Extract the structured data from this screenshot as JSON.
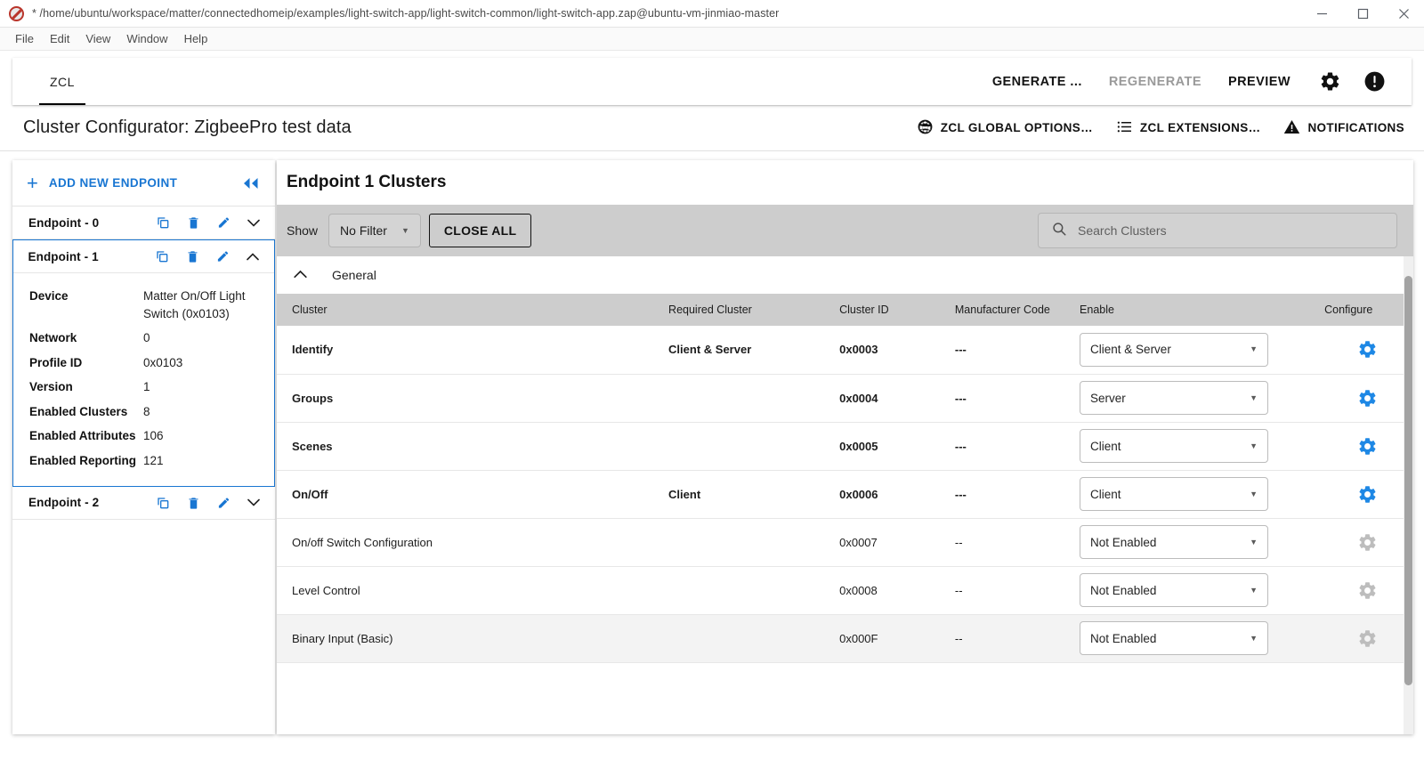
{
  "window": {
    "title": "* /home/ubuntu/workspace/matter/connectedhomeip/examples/light-switch-app/light-switch-common/light-switch-app.zap@ubuntu-vm-jinmiao-master",
    "logo_icon": "zap-logo-icon",
    "minimize_icon": "minimize-icon",
    "maximize_icon": "maximize-icon",
    "close_icon": "close-icon"
  },
  "menubar": {
    "items": [
      {
        "label": "File"
      },
      {
        "label": "Edit"
      },
      {
        "label": "View"
      },
      {
        "label": "Window"
      },
      {
        "label": "Help"
      }
    ]
  },
  "appbar": {
    "tabs": [
      {
        "label": "ZCL",
        "active": true
      }
    ],
    "actions": [
      {
        "label": "GENERATE ...",
        "disabled": false
      },
      {
        "label": "REGENERATE",
        "disabled": true
      },
      {
        "label": "PREVIEW",
        "disabled": false
      }
    ],
    "settings_icon": "gear-icon",
    "alert_icon": "exclamation-circle-icon"
  },
  "page_header": {
    "title": "Cluster Configurator: ZigbeePro test data",
    "actions": [
      {
        "label": "ZCL GLOBAL OPTIONS…",
        "icon": "globe-icon"
      },
      {
        "label": "ZCL EXTENSIONS…",
        "icon": "list-icon"
      },
      {
        "label": "NOTIFICATIONS",
        "icon": "warning-triangle-icon"
      }
    ]
  },
  "sidebar": {
    "add_endpoint_label": "ADD NEW ENDPOINT",
    "add_icon": "plus-icon",
    "collapse_icon": "collapse-left-icon",
    "row_icons": {
      "copy": "copy-icon",
      "delete": "trash-icon",
      "edit": "pencil-icon",
      "expand": "chevron-down-icon",
      "collapse": "chevron-up-icon"
    },
    "endpoints": [
      {
        "label": "Endpoint - 0",
        "expanded": false,
        "selected": false
      },
      {
        "label": "Endpoint - 1",
        "expanded": true,
        "selected": true
      },
      {
        "label": "Endpoint - 2",
        "expanded": false,
        "selected": false
      }
    ],
    "endpoint_detail": [
      {
        "key": "Device",
        "value": "Matter On/Off Light Switch (0x0103)"
      },
      {
        "key": "Network",
        "value": "0"
      },
      {
        "key": "Profile ID",
        "value": "0x0103"
      },
      {
        "key": "Version",
        "value": "1"
      },
      {
        "key": "Enabled Clusters",
        "value": "8"
      },
      {
        "key": "Enabled Attributes",
        "value": "106"
      },
      {
        "key": "Enabled Reporting",
        "value": "121"
      }
    ]
  },
  "content": {
    "title": "Endpoint 1 Clusters",
    "show_label": "Show",
    "filter_value": "No Filter",
    "close_all_label": "CLOSE ALL",
    "search": {
      "placeholder": "Search Clusters",
      "value": "",
      "icon": "search-icon"
    },
    "group": {
      "name": "General",
      "expanded": true,
      "icon": "chevron-up-icon"
    },
    "columns": [
      "Cluster",
      "Required Cluster",
      "Cluster ID",
      "Manufacturer Code",
      "Enable",
      "Configure"
    ],
    "rows": [
      {
        "cluster": "Identify",
        "required": "Client & Server",
        "id": "0x0003",
        "mfg": "---",
        "enable": "Client & Server",
        "enabled": true,
        "hover": false,
        "configure_icon": "gear-icon"
      },
      {
        "cluster": "Groups",
        "required": "",
        "id": "0x0004",
        "mfg": "---",
        "enable": "Server",
        "enabled": true,
        "hover": false,
        "configure_icon": "gear-icon"
      },
      {
        "cluster": "Scenes",
        "required": "",
        "id": "0x0005",
        "mfg": "---",
        "enable": "Client",
        "enabled": true,
        "hover": false,
        "configure_icon": "gear-icon"
      },
      {
        "cluster": "On/Off",
        "required": "Client",
        "id": "0x0006",
        "mfg": "---",
        "enable": "Client",
        "enabled": true,
        "hover": false,
        "configure_icon": "gear-icon"
      },
      {
        "cluster": "On/off Switch Configuration",
        "required": "",
        "id": "0x0007",
        "mfg": "--",
        "enable": "Not Enabled",
        "enabled": false,
        "hover": false,
        "configure_icon": "gear-icon"
      },
      {
        "cluster": "Level Control",
        "required": "",
        "id": "0x0008",
        "mfg": "--",
        "enable": "Not Enabled",
        "enabled": false,
        "hover": false,
        "configure_icon": "gear-icon"
      },
      {
        "cluster": "Binary Input (Basic)",
        "required": "",
        "id": "0x000F",
        "mfg": "--",
        "enable": "Not Enabled",
        "enabled": false,
        "hover": true,
        "configure_icon": "gear-icon"
      }
    ]
  },
  "colors": {
    "accent_blue": "#1976d2",
    "gear_blue": "#1e88e5",
    "toolbar_gray": "#cdcdcd",
    "disabled_gray": "#9a9a9a",
    "gear_disabled": "#bdbdbd"
  }
}
